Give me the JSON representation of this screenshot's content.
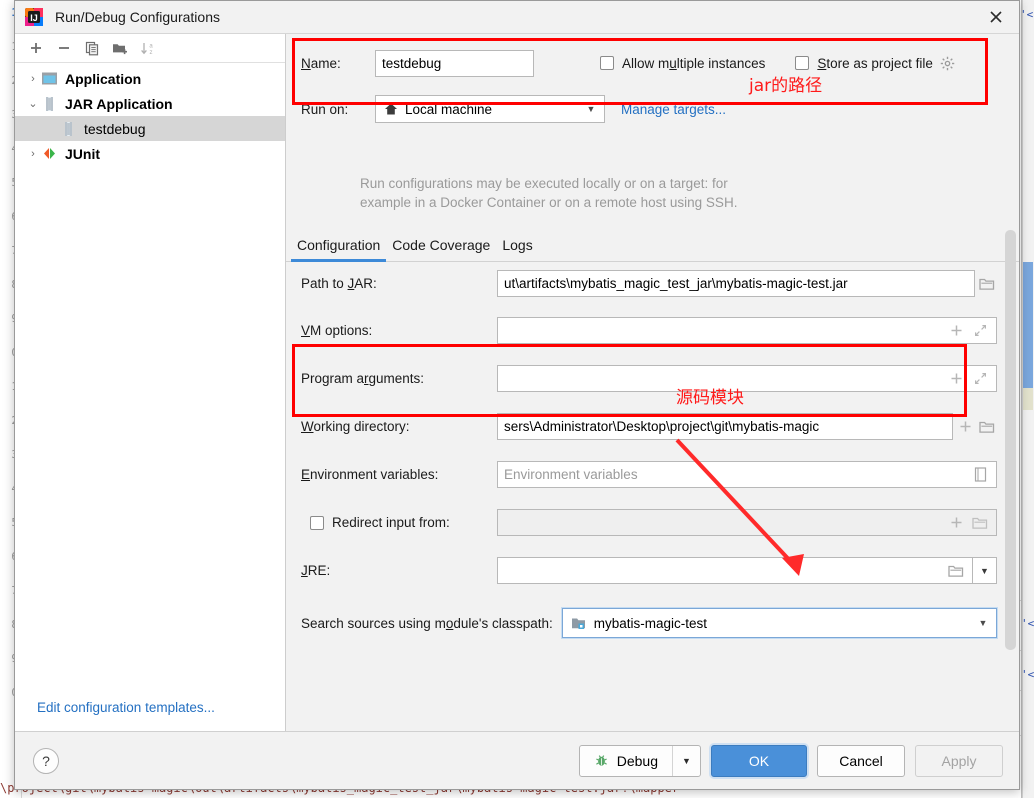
{
  "window": {
    "title": "Run/Debug Configurations",
    "app_icon": "intellij-idea-icon",
    "close_icon": "close-icon"
  },
  "tree_toolbar": {
    "buttons": [
      {
        "name": "add-configuration-button",
        "glyph": "+",
        "label": "Add New Configuration"
      },
      {
        "name": "remove-configuration-button",
        "glyph": "−",
        "label": "Remove Configuration"
      },
      {
        "name": "copy-configuration-button",
        "glyph": "copy-icon",
        "label": "Copy Configuration"
      },
      {
        "name": "new-folder-button",
        "glyph": "folder-add-icon",
        "label": "Create New Folder"
      },
      {
        "name": "sort-configurations-button",
        "glyph": "sort-az-icon",
        "label": "Sort Configurations"
      }
    ]
  },
  "tree": {
    "items": [
      {
        "label": "Application",
        "icon": "application-icon",
        "twisty": "›",
        "selected": false,
        "child": false
      },
      {
        "label": "JAR Application",
        "icon": "jar-icon",
        "twisty": "⌄",
        "selected": false,
        "child": false
      },
      {
        "label": "testdebug",
        "icon": "jar-icon",
        "twisty": "",
        "selected": true,
        "child": true
      },
      {
        "label": "JUnit",
        "icon": "junit-icon",
        "twisty": "›",
        "selected": false,
        "child": false
      }
    ],
    "edit_templates_link": "Edit configuration templates..."
  },
  "header": {
    "name_label": "Name:",
    "name_label_mnemonic": "N",
    "name_value": "testdebug",
    "allow_multiple_instances_label": "Allow multiple instances",
    "allow_multiple_instances_checked": false,
    "store_as_project_file_label": "Store as project file",
    "store_as_project_file_checked": false,
    "store_gear_icon": "gear-icon",
    "run_on_label": "Run on:",
    "run_on_value": "Local machine",
    "run_on_icon": "home-icon",
    "manage_targets_link": "Manage targets...",
    "hint_line1": "Run configurations may be executed locally or on a target: for",
    "hint_line2": "example in a Docker Container or on a remote host using SSH."
  },
  "tabs": [
    {
      "label": "Configuration",
      "active": true
    },
    {
      "label": "Code Coverage",
      "active": false
    },
    {
      "label": "Logs",
      "active": false
    }
  ],
  "form": {
    "path_to_jar": {
      "label": "Path to JAR:",
      "mnemonic": "J",
      "value": "ut\\artifacts\\mybatis_magic_test_jar\\mybatis-magic-test.jar",
      "browse_icon": "folder-browse-icon"
    },
    "vm_options": {
      "label": "VM options:",
      "mnemonic": "V",
      "value": "",
      "macro_icon": "insert-macro-icon",
      "expand_icon": "expand-icon"
    },
    "program_arguments": {
      "label": "Program arguments:",
      "mnemonic": "r",
      "value": "",
      "macro_icon": "insert-macro-icon",
      "expand_icon": "expand-icon"
    },
    "working_directory": {
      "label": "Working directory:",
      "mnemonic": "W",
      "value": "sers\\Administrator\\Desktop\\project\\git\\mybatis-magic",
      "macro_icon": "insert-macro-icon",
      "browse_icon": "folder-browse-icon"
    },
    "environment_variables": {
      "label": "Environment variables:",
      "mnemonic": "E",
      "value": "",
      "placeholder": "Environment variables",
      "editor_icon": "env-editor-icon"
    },
    "redirect_input": {
      "label": "Redirect input from:",
      "checked": false,
      "value": "",
      "macro_icon": "insert-macro-icon",
      "browse_icon": "folder-browse-icon"
    },
    "jre": {
      "label": "JRE:",
      "mnemonic": "J",
      "value": "",
      "browse_icon": "folder-browse-icon",
      "caret_icon": "chevron-down-icon"
    },
    "search_sources_module": {
      "label": "Search sources using module's classpath:",
      "mnemonic": "o",
      "value": "mybatis-magic-test",
      "module_icon": "module-icon",
      "caret_icon": "chevron-down-icon"
    }
  },
  "annotations": {
    "jar_path_note": "jar的路径",
    "source_module_note": "源码模块",
    "box_color": "#ff0000",
    "arrow_color": "#ff2a2a"
  },
  "footer": {
    "help_label": "?",
    "debug_label": "Debug",
    "debug_icon": "bug-icon",
    "debug_caret": "▼",
    "ok_label": "OK",
    "cancel_label": "Cancel",
    "apply_label": "Apply",
    "apply_enabled": false,
    "ok_color": "#4a90d9"
  },
  "background": {
    "line_numbers": [
      "1",
      "1",
      "2",
      "3",
      "4",
      "5",
      "6",
      "7",
      "8",
      "9",
      "0",
      "1",
      "2",
      "3",
      "4",
      "5",
      "6",
      "7",
      "8",
      "9",
      "0"
    ],
    "bottom_code": "\\project\\git\\mybatis-magic\\out\\artifacts\\mybatis_magic_test_jar\\mybatis-magic-test.jar!\\mapper"
  }
}
